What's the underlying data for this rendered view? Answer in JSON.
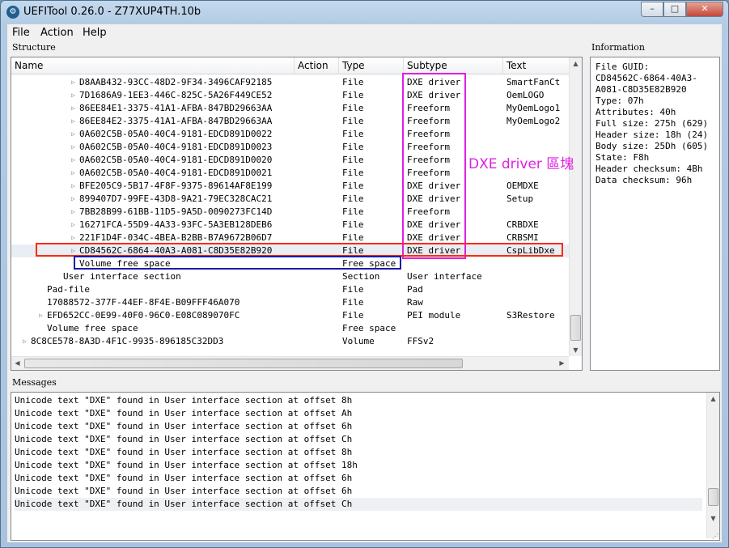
{
  "window": {
    "title": "UEFITool 0.26.0 - Z77XUP4TH.10b",
    "minimize_glyph": "–",
    "maximize_glyph": "□",
    "close_glyph": "✕"
  },
  "menu": [
    "File",
    "Action",
    "Help"
  ],
  "structure": {
    "label": "Structure",
    "columns": [
      "Name",
      "Action",
      "Type",
      "Subtype",
      "Text"
    ],
    "rows": [
      {
        "name": "D8AAB432-93CC-48D2-9F34-3496CAF92185",
        "type": "File",
        "subtype": "DXE driver",
        "text": "SmartFanCt",
        "indent": 3,
        "arrow": true
      },
      {
        "name": "7D1686A9-1EE3-446C-825C-5A26F449CE52",
        "type": "File",
        "subtype": "DXE driver",
        "text": "OemLOGO",
        "indent": 3,
        "arrow": true
      },
      {
        "name": "86EE84E1-3375-41A1-AFBA-847BD29663AA",
        "type": "File",
        "subtype": "Freeform",
        "text": "MyOemLogo1",
        "indent": 3,
        "arrow": true
      },
      {
        "name": "86EE84E2-3375-41A1-AFBA-847BD29663AA",
        "type": "File",
        "subtype": "Freeform",
        "text": "MyOemLogo2",
        "indent": 3,
        "arrow": true
      },
      {
        "name": "0A602C5B-05A0-40C4-9181-EDCD891D0022",
        "type": "File",
        "subtype": "Freeform",
        "text": "",
        "indent": 3,
        "arrow": true
      },
      {
        "name": "0A602C5B-05A0-40C4-9181-EDCD891D0023",
        "type": "File",
        "subtype": "Freeform",
        "text": "",
        "indent": 3,
        "arrow": true
      },
      {
        "name": "0A602C5B-05A0-40C4-9181-EDCD891D0020",
        "type": "File",
        "subtype": "Freeform",
        "text": "",
        "indent": 3,
        "arrow": true
      },
      {
        "name": "0A602C5B-05A0-40C4-9181-EDCD891D0021",
        "type": "File",
        "subtype": "Freeform",
        "text": "",
        "indent": 3,
        "arrow": true
      },
      {
        "name": "BFE205C9-5B17-4F8F-9375-89614AF8E199",
        "type": "File",
        "subtype": "DXE driver",
        "text": "OEMDXE",
        "indent": 3,
        "arrow": true
      },
      {
        "name": "899407D7-99FE-43D8-9A21-79EC328CAC21",
        "type": "File",
        "subtype": "DXE driver",
        "text": "Setup",
        "indent": 3,
        "arrow": true
      },
      {
        "name": "7BB28B99-61BB-11D5-9A5D-0090273FC14D",
        "type": "File",
        "subtype": "Freeform",
        "text": "",
        "indent": 3,
        "arrow": true
      },
      {
        "name": "16271FCA-55D9-4A33-93FC-5A3EB128DEB6",
        "type": "File",
        "subtype": "DXE driver",
        "text": "CRBDXE",
        "indent": 3,
        "arrow": true
      },
      {
        "name": "221F1D4F-034C-4BEA-B2BB-B7A9672B06D7",
        "type": "File",
        "subtype": "DXE driver",
        "text": "CRBSMI",
        "indent": 3,
        "arrow": true
      },
      {
        "name": "CD84562C-6864-40A3-A081-C8D35E82B920",
        "type": "File",
        "subtype": "DXE driver",
        "text": "CspLibDxe",
        "indent": 3,
        "arrow": true,
        "selected": true
      },
      {
        "name": "Volume free space",
        "type": "Free space",
        "subtype": "",
        "text": "",
        "indent": 3,
        "arrow": false
      },
      {
        "name": "User interface section",
        "type": "Section",
        "subtype": "User interface",
        "text": "",
        "indent": 2,
        "arrow": false
      },
      {
        "name": "Pad-file",
        "type": "File",
        "subtype": "Pad",
        "text": "",
        "indent": 1,
        "arrow": false
      },
      {
        "name": "17088572-377F-44EF-8F4E-B09FFF46A070",
        "type": "File",
        "subtype": "Raw",
        "text": "",
        "indent": 1,
        "arrow": false
      },
      {
        "name": "EFD652CC-0E99-40F0-96C0-E08C089070FC",
        "type": "File",
        "subtype": "PEI module",
        "text": "S3Restore",
        "indent": 1,
        "arrow": true
      },
      {
        "name": "Volume free space",
        "type": "Free space",
        "subtype": "",
        "text": "",
        "indent": 1,
        "arrow": false
      },
      {
        "name": "8C8CE578-8A3D-4F1C-9935-896185C32DD3",
        "type": "Volume",
        "subtype": "FFSv2",
        "text": "",
        "indent": 0,
        "arrow": true
      }
    ]
  },
  "information": {
    "label": "Information",
    "lines": [
      "File GUID:",
      "CD84562C-6864-40A3-",
      "A081-C8D35E82B920",
      "Type: 07h",
      "Attributes: 40h",
      "Full size: 275h (629)",
      "Header size: 18h (24)",
      "Body size: 25Dh (605)",
      "State: F8h",
      "Header checksum: 4Bh",
      "Data checksum: 96h"
    ]
  },
  "messages": {
    "label": "Messages",
    "lines": [
      "Unicode text \"DXE\" found in User interface section at offset 8h",
      "Unicode text \"DXE\" found in User interface section at offset Ah",
      "Unicode text \"DXE\" found in User interface section at offset 6h",
      "Unicode text \"DXE\" found in User interface section at offset Ch",
      "Unicode text \"DXE\" found in User interface section at offset 8h",
      "Unicode text \"DXE\" found in User interface section at offset 18h",
      "Unicode text \"DXE\" found in User interface section at offset 6h",
      "Unicode text \"DXE\" found in User interface section at offset 6h",
      "Unicode text \"DXE\" found in User interface section at offset Ch"
    ]
  },
  "annotation": {
    "text": "DXE driver 區塊",
    "color_magenta": "#e020e0",
    "color_red": "#ff2a00",
    "color_blue": "#1a1aa8"
  }
}
